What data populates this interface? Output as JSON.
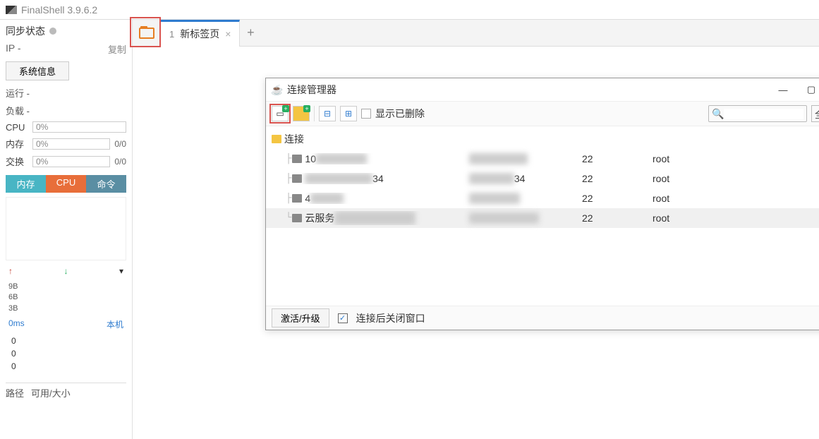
{
  "app": {
    "title": "FinalShell 3.9.6.2"
  },
  "sidebar": {
    "sync_label": "同步状态",
    "ip_label": "IP",
    "ip_value": "-",
    "copy_label": "复制",
    "sysinfo_btn": "系统信息",
    "run_label": "运行 -",
    "load_label": "负载 -",
    "cpu_label": "CPU",
    "cpu_pct": "0%",
    "mem_label": "内存",
    "mem_pct": "0%",
    "mem_val": "0/0",
    "swap_label": "交换",
    "swap_pct": "0%",
    "swap_val": "0/0",
    "tab_mem": "内存",
    "tab_cpu": "CPU",
    "tab_cmd": "命令",
    "y_9b": "9B",
    "y_6b": "6B",
    "y_3b": "3B",
    "ms_label": "0ms",
    "host_label": "本机",
    "z0": "0",
    "z1": "0",
    "z2": "0",
    "bottom1": "路径",
    "bottom2": "可用/大小"
  },
  "tabs": {
    "tab1_idx": "1",
    "tab1_label": "新标签页"
  },
  "bg_roots": {
    "r1": "root",
    "r2": "root",
    "r3": "root",
    "r4": "root"
  },
  "dialog": {
    "title": "连接管理器",
    "show_deleted": "显示已删除",
    "filter_all": "全部",
    "search_placeholder": "",
    "root_label": "连接",
    "rows": [
      {
        "name_prefix": "10",
        "name_blur": "1.XXX.XXX",
        "host_blur": "10.X.XXX.XX",
        "port": "22",
        "user": "root"
      },
      {
        "name_prefix": "",
        "name_blur": "XXX.XXX.XXX.",
        "name_suffix": "34",
        "host_blur": "XXX.XXX.",
        "host_suffix": "34",
        "port": "22",
        "user": "root"
      },
      {
        "name_prefix": "4",
        "name_blur": "XXXXX",
        "host_blur": "1X.XXX.XX",
        "port": "22",
        "user": "root"
      },
      {
        "name_prefix": "云服务",
        "name_blur": "器XXX.XXX.X.120",
        "host_blur": "192.1X.XXX.XX",
        "port": "22",
        "user": "root"
      }
    ],
    "activate_btn": "激活/升级",
    "close_after_label": "连接后关闭窗口"
  }
}
